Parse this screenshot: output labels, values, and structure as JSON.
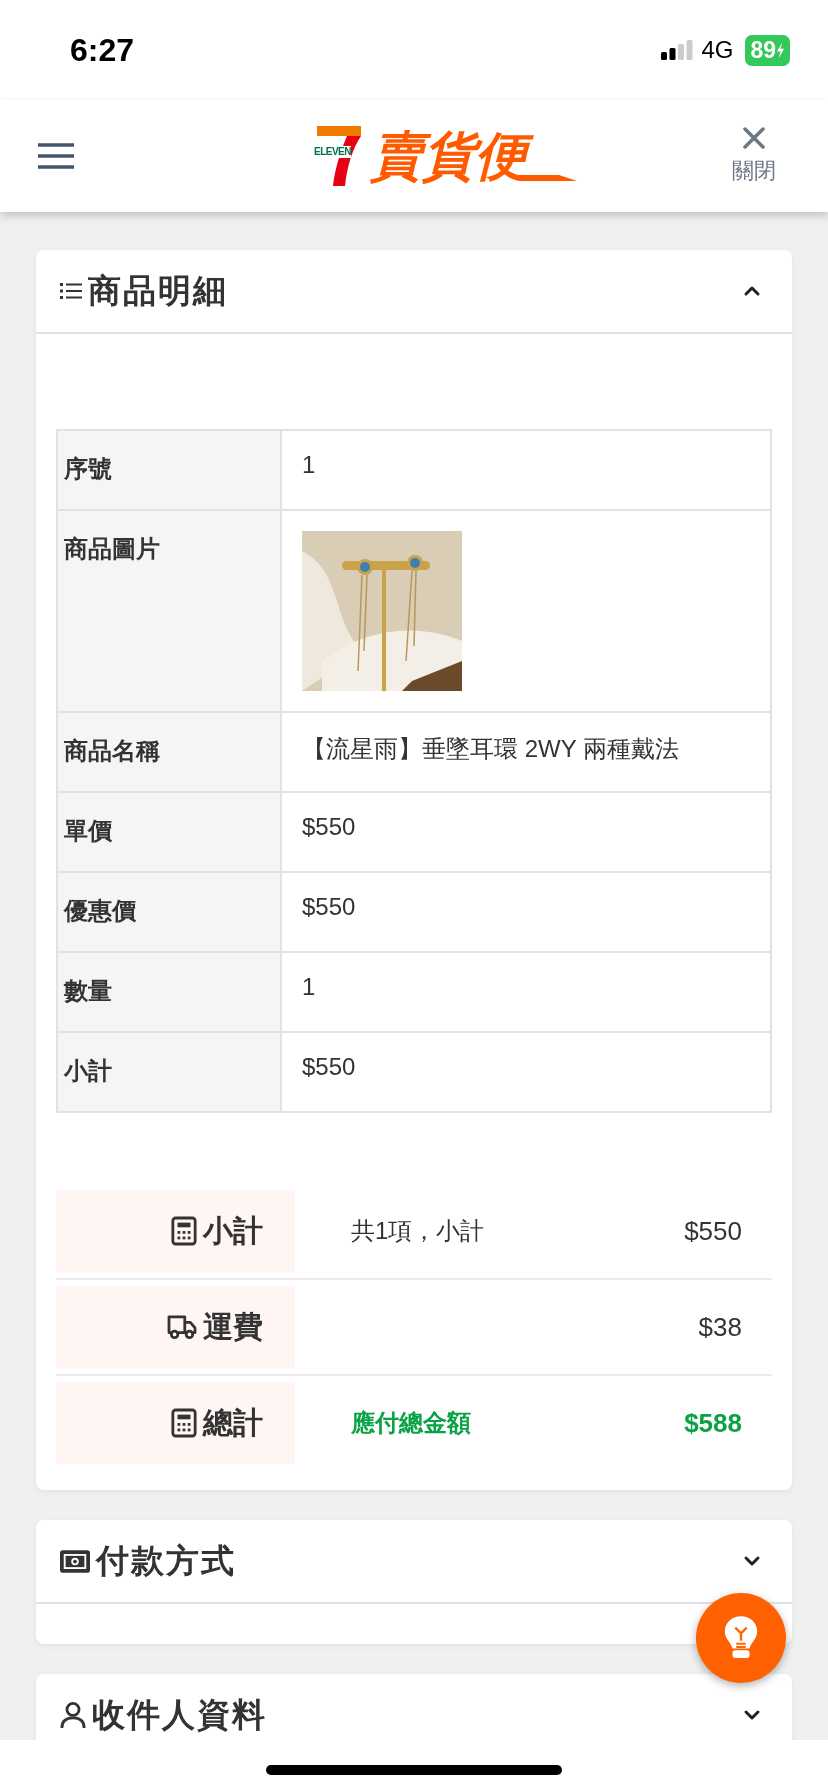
{
  "status_bar": {
    "time": "6:27",
    "network": "4G",
    "battery": "89"
  },
  "header": {
    "logo_mark": "ELEVEN",
    "logo_text": "賣貨便",
    "close_label": "關閉"
  },
  "product_details": {
    "title": "商品明細",
    "expanded": true,
    "rows": [
      {
        "kind": "text",
        "label": "序號",
        "value": "1"
      },
      {
        "kind": "picture",
        "label": "商品圖片"
      },
      {
        "kind": "text",
        "label": "商品名稱",
        "value": "【流星雨】垂墜耳環 2WY 兩種戴法"
      },
      {
        "kind": "text",
        "label": "單價",
        "value": "$550"
      },
      {
        "kind": "text",
        "label": "優惠價",
        "value": "$550"
      },
      {
        "kind": "text",
        "label": "數量",
        "value": "1"
      },
      {
        "kind": "text",
        "label": "小計",
        "value": "$550"
      }
    ],
    "summary": [
      {
        "kind": "subtotal",
        "label": "小計",
        "note": "共1項，小計",
        "amount": "$550"
      },
      {
        "kind": "shipping",
        "label": "運費",
        "amount": "$38"
      },
      {
        "kind": "total",
        "label": "總計",
        "note": "應付總金額",
        "amount": "$588"
      }
    ]
  },
  "sections": [
    {
      "kind": "payment",
      "title": "付款方式",
      "expanded": false
    },
    {
      "kind": "recipient",
      "title": "收件人資料",
      "expanded": false
    }
  ]
}
